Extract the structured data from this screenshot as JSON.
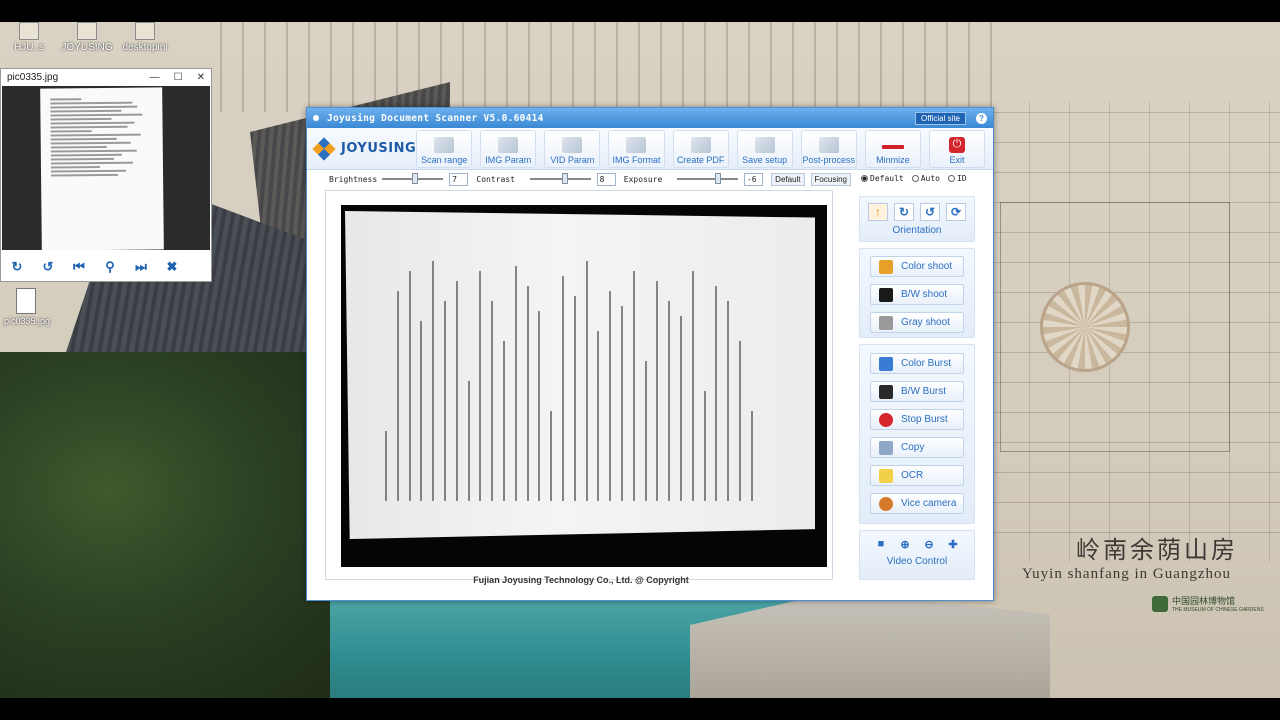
{
  "desktop": {
    "icons": [
      {
        "label": "HJU..s",
        "icon": "shortcut-icon"
      },
      {
        "label": "JOYUSING",
        "icon": "folder-icon"
      },
      {
        "label": "desktopini",
        "icon": "file-icon"
      }
    ],
    "file_icon_label": "pic0335.jpg",
    "wallpaper": {
      "title_cn": "岭南余荫山房",
      "title_en": "Yuyin shanfang in Guangzhou",
      "museum_cn": "中国园林博物馆",
      "museum_en": "THE MUSEUM OF CHINESE GARDENS"
    }
  },
  "viewer": {
    "title": "pic0335.jpg",
    "window_buttons": [
      "—",
      "☐",
      "✕"
    ],
    "toolbar": [
      {
        "name": "rotate-right-icon",
        "glyph": "↻"
      },
      {
        "name": "rotate-left-icon",
        "glyph": "↺"
      },
      {
        "name": "first-image-icon",
        "glyph": "⏮"
      },
      {
        "name": "zoom-icon",
        "glyph": "⚲"
      },
      {
        "name": "last-image-icon",
        "glyph": "⏭"
      },
      {
        "name": "close-icon",
        "glyph": "✖"
      }
    ]
  },
  "app": {
    "title": "Joyusing Document Scanner V5.0.60414",
    "official_site": "Official site",
    "help": "?",
    "logo": "JOYUSING",
    "toolbar": [
      {
        "label": "Scan range",
        "icon": "scan-range-icon"
      },
      {
        "label": "IMG Param",
        "icon": "img-param-icon"
      },
      {
        "label": "VID Param",
        "icon": "vid-param-icon"
      },
      {
        "label": "IMG Format",
        "icon": "img-format-icon"
      },
      {
        "label": "Create PDF",
        "icon": "create-pdf-icon"
      },
      {
        "label": "Save setup",
        "icon": "save-setup-icon"
      },
      {
        "label": "Post-process",
        "icon": "post-process-icon"
      },
      {
        "label": "Minmize",
        "icon": "minimize-icon"
      },
      {
        "label": "Exit",
        "icon": "exit-icon"
      }
    ],
    "params": {
      "brightness_label": "Brightness",
      "brightness_value": "7",
      "contrast_label": "Contrast",
      "contrast_value": "8",
      "exposure_label": "Exposure",
      "exposure_value": "-6",
      "default_btn": "Default",
      "focusing_btn": "Focusing"
    },
    "modes": {
      "default": "Default",
      "auto": "Auto",
      "id": "ID",
      "selected": "Default"
    },
    "orientation_label": "Orientation",
    "orientation_icons": [
      {
        "name": "rotate-up-icon",
        "glyph": "↑"
      },
      {
        "name": "rotate-cw-icon",
        "glyph": "↻"
      },
      {
        "name": "rotate-ccw-icon",
        "glyph": "↺"
      },
      {
        "name": "refresh-icon",
        "glyph": "⟳"
      }
    ],
    "shoot_buttons": [
      {
        "label": "Color shoot",
        "icon": "color-shoot-icon",
        "color": "#e8a02a"
      },
      {
        "label": "B/W shoot",
        "icon": "bw-shoot-icon",
        "color": "#1a1a1a"
      },
      {
        "label": "Gray shoot",
        "icon": "gray-shoot-icon",
        "color": "#9a9a9a"
      }
    ],
    "burst_buttons": [
      {
        "label": "Color Burst",
        "icon": "color-burst-icon",
        "color": "#3a7bd5"
      },
      {
        "label": "B/W Burst",
        "icon": "bw-burst-icon",
        "color": "#2a2a2a"
      },
      {
        "label": "Stop Burst",
        "icon": "stop-burst-icon",
        "color": "#d4262c"
      },
      {
        "label": "Copy",
        "icon": "copy-icon",
        "color": "#8fa8c8"
      },
      {
        "label": "OCR",
        "icon": "ocr-icon",
        "color": "#f3d04a"
      },
      {
        "label": "Vice camera",
        "icon": "vice-camera-icon",
        "color": "#d57a2a"
      }
    ],
    "video_label": "Video Control",
    "video_icons": [
      {
        "name": "video-camera-icon",
        "glyph": "■"
      },
      {
        "name": "zoom-in-icon",
        "glyph": "⊕"
      },
      {
        "name": "zoom-out-icon",
        "glyph": "⊖"
      },
      {
        "name": "fit-icon",
        "glyph": "✚"
      }
    ],
    "copyright": "Fujian Joyusing Technology Co., Ltd. @ Copyright"
  }
}
